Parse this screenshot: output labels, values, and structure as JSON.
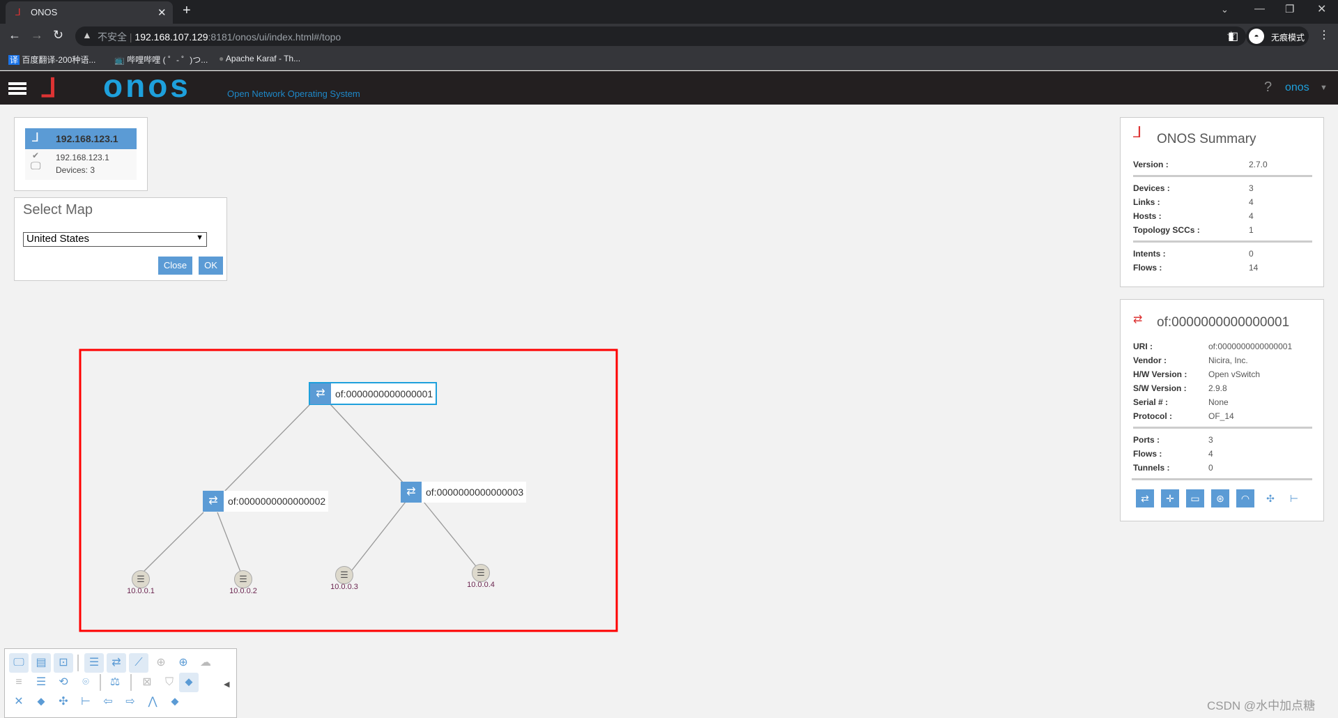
{
  "browser": {
    "tab_title": "ONOS",
    "url_warning": "不安全",
    "url_host": "192.168.107.129",
    "url_rest": ":8181/onos/ui/index.html#/topo",
    "incognito_label": "无痕模式",
    "bookmarks": [
      {
        "label": "百度翻译-200种语...",
        "icon": "translate-icon"
      },
      {
        "label": "哔哩哔哩 ( ゜- ゜)つ...",
        "icon": "bilibili-icon"
      },
      {
        "label": "Apache Karaf - Th...",
        "icon": "globe-icon"
      }
    ]
  },
  "header": {
    "logo_text": "onos",
    "subtitle": "Open Network Operating System",
    "help": "?",
    "user": "onos"
  },
  "instance": {
    "title": "192.168.123.1",
    "ip": "192.168.123.1",
    "devices": "Devices: 3"
  },
  "select_map": {
    "title": "Select Map",
    "selected": "United States",
    "close_label": "Close",
    "ok_label": "OK"
  },
  "topology": {
    "devices": [
      {
        "id": "of:0000000000000001"
      },
      {
        "id": "of:0000000000000002"
      },
      {
        "id": "of:0000000000000003"
      }
    ],
    "hosts": [
      {
        "ip": "10.0.0.1"
      },
      {
        "ip": "10.0.0.2"
      },
      {
        "ip": "10.0.0.3"
      },
      {
        "ip": "10.0.0.4"
      }
    ],
    "highlight_color": "#ff0000"
  },
  "summary": {
    "title": "ONOS Summary",
    "rows": [
      {
        "label": "Version :",
        "value": "2.7.0"
      },
      {
        "label": "Devices :",
        "value": "3"
      },
      {
        "label": "Links :",
        "value": "4"
      },
      {
        "label": "Hosts :",
        "value": "4"
      },
      {
        "label": "Topology SCCs :",
        "value": "1"
      },
      {
        "label": "Intents :",
        "value": "0"
      },
      {
        "label": "Flows :",
        "value": "14"
      }
    ]
  },
  "device": {
    "title": "of:0000000000000001",
    "rows": [
      {
        "label": "URI :",
        "value": "of:0000000000000001"
      },
      {
        "label": "Vendor :",
        "value": "Nicira, Inc."
      },
      {
        "label": "H/W Version :",
        "value": "Open vSwitch"
      },
      {
        "label": "S/W Version :",
        "value": "2.9.8"
      },
      {
        "label": "Serial # :",
        "value": "None"
      },
      {
        "label": "Protocol :",
        "value": "OF_14"
      },
      {
        "label": "Ports :",
        "value": "3"
      },
      {
        "label": "Flows :",
        "value": "4"
      },
      {
        "label": "Tunnels :",
        "value": "0"
      }
    ]
  },
  "watermark": "CSDN @水中加点糖",
  "accent": "#5b9bd5"
}
